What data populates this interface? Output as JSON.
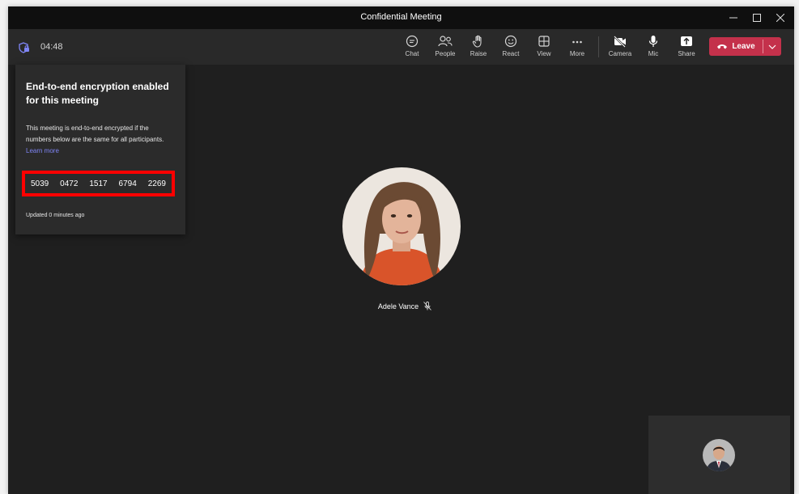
{
  "window": {
    "title": "Confidential Meeting"
  },
  "toolbar": {
    "timer": "04:48",
    "buttons": [
      {
        "label": "Chat",
        "icon": "chat-icon"
      },
      {
        "label": "People",
        "icon": "people-icon"
      },
      {
        "label": "Raise",
        "icon": "raise-hand-icon"
      },
      {
        "label": "React",
        "icon": "react-icon"
      },
      {
        "label": "View",
        "icon": "view-icon"
      },
      {
        "label": "More",
        "icon": "more-icon"
      },
      {
        "label": "Camera",
        "icon": "camera-off-icon"
      },
      {
        "label": "Mic",
        "icon": "mic-icon"
      },
      {
        "label": "Share",
        "icon": "share-icon"
      }
    ],
    "leave_label": "Leave"
  },
  "encryption_panel": {
    "title": "End-to-end encryption enabled for this meeting",
    "body": "This meeting is end-to-end encrypted if the numbers below are the same for all participants.",
    "learn_more": "Learn more",
    "codes": [
      "5039",
      "0472",
      "1517",
      "6794",
      "2269"
    ],
    "updated": "Updated 0 minutes ago"
  },
  "participant": {
    "name": "Adele Vance",
    "muted": true
  },
  "colors": {
    "leave": "#c4314b",
    "highlight": "#ff0000",
    "link": "#7f85f5"
  }
}
